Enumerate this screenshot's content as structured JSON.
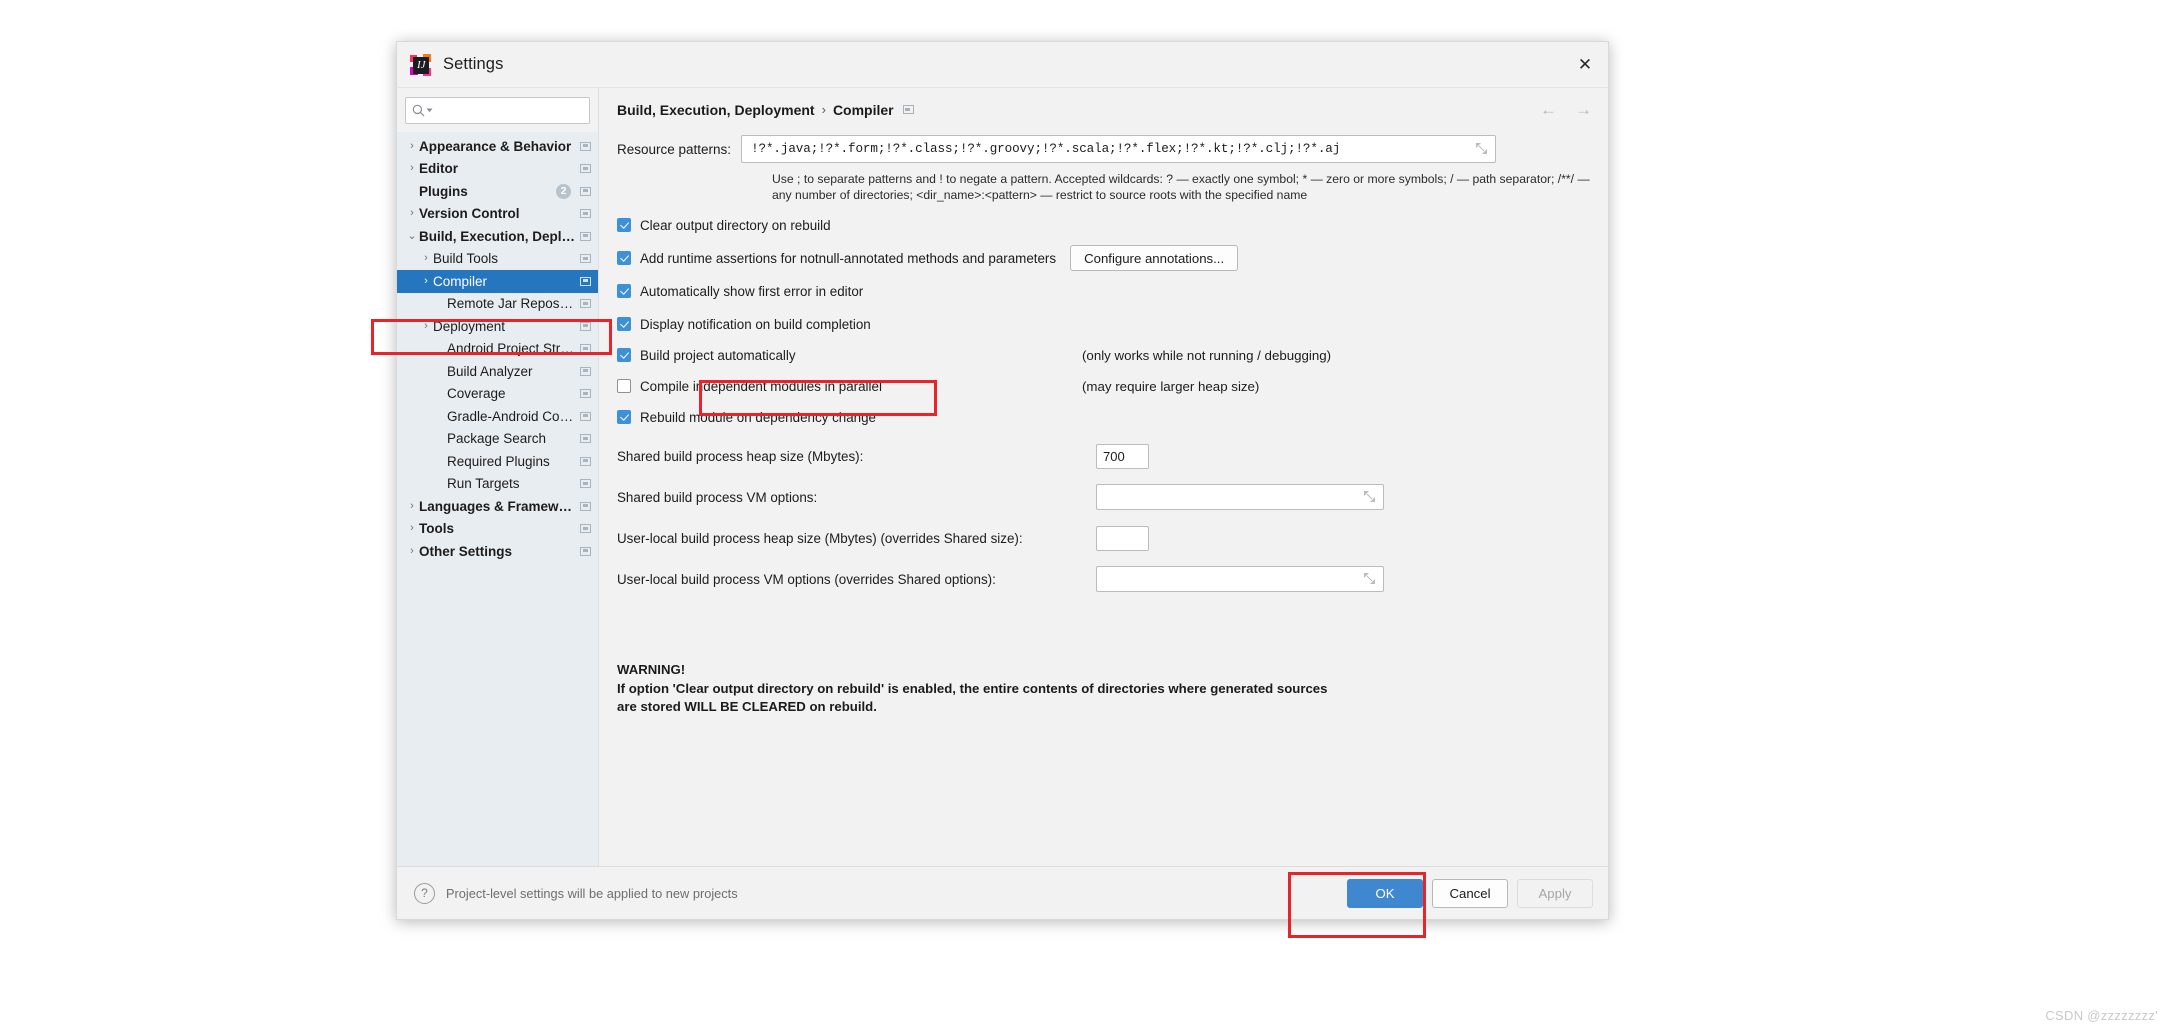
{
  "window": {
    "title": "Settings",
    "app_icon": "intellij-idea-icon",
    "close_label": "✕"
  },
  "search": {
    "placeholder": "",
    "value": "",
    "icon": "search-icon"
  },
  "sidebar": {
    "items": [
      {
        "label": "Appearance & Behavior",
        "arrow": "›",
        "bold": true,
        "indent": 1,
        "selected": false,
        "badge": null,
        "monitor": true
      },
      {
        "label": "Editor",
        "arrow": "›",
        "bold": true,
        "indent": 1,
        "selected": false,
        "badge": null,
        "monitor": true
      },
      {
        "label": "Plugins",
        "arrow": "",
        "bold": true,
        "indent": 1,
        "selected": false,
        "badge": "2",
        "monitor": true
      },
      {
        "label": "Version Control",
        "arrow": "›",
        "bold": true,
        "indent": 1,
        "selected": false,
        "badge": null,
        "monitor": true
      },
      {
        "label": "Build, Execution, Deployment",
        "arrow": "⌄",
        "bold": true,
        "indent": 1,
        "selected": false,
        "badge": null,
        "monitor": true
      },
      {
        "label": "Build Tools",
        "arrow": "›",
        "bold": false,
        "indent": 2,
        "selected": false,
        "badge": null,
        "monitor": true
      },
      {
        "label": "Compiler",
        "arrow": "›",
        "bold": false,
        "indent": 2,
        "selected": true,
        "badge": null,
        "monitor": true
      },
      {
        "label": "Remote Jar Repositories",
        "arrow": "",
        "bold": false,
        "indent": 3,
        "selected": false,
        "badge": null,
        "monitor": true
      },
      {
        "label": "Deployment",
        "arrow": "›",
        "bold": false,
        "indent": 2,
        "selected": false,
        "badge": null,
        "monitor": true
      },
      {
        "label": "Android Project Structure",
        "arrow": "",
        "bold": false,
        "indent": 3,
        "selected": false,
        "badge": null,
        "monitor": true
      },
      {
        "label": "Build Analyzer",
        "arrow": "",
        "bold": false,
        "indent": 3,
        "selected": false,
        "badge": null,
        "monitor": true
      },
      {
        "label": "Coverage",
        "arrow": "",
        "bold": false,
        "indent": 3,
        "selected": false,
        "badge": null,
        "monitor": true
      },
      {
        "label": "Gradle-Android Compiler",
        "arrow": "",
        "bold": false,
        "indent": 3,
        "selected": false,
        "badge": null,
        "monitor": true
      },
      {
        "label": "Package Search",
        "arrow": "",
        "bold": false,
        "indent": 3,
        "selected": false,
        "badge": null,
        "monitor": true
      },
      {
        "label": "Required Plugins",
        "arrow": "",
        "bold": false,
        "indent": 3,
        "selected": false,
        "badge": null,
        "monitor": true
      },
      {
        "label": "Run Targets",
        "arrow": "",
        "bold": false,
        "indent": 3,
        "selected": false,
        "badge": null,
        "monitor": true
      },
      {
        "label": "Languages & Frameworks",
        "arrow": "›",
        "bold": true,
        "indent": 1,
        "selected": false,
        "badge": null,
        "monitor": true
      },
      {
        "label": "Tools",
        "arrow": "›",
        "bold": true,
        "indent": 1,
        "selected": false,
        "badge": null,
        "monitor": true
      },
      {
        "label": "Other Settings",
        "arrow": "›",
        "bold": true,
        "indent": 1,
        "selected": false,
        "badge": null,
        "monitor": true
      }
    ]
  },
  "breadcrumb": {
    "root": "Build, Execution, Deployment",
    "separator": "›",
    "leaf": "Compiler",
    "back_arrow": "←",
    "forward_arrow": "→"
  },
  "main": {
    "resource_patterns": {
      "label": "Resource patterns:",
      "value": "!?*.java;!?*.form;!?*.class;!?*.groovy;!?*.scala;!?*.flex;!?*.kt;!?*.clj;!?*.aj",
      "expand_icon": "expand-icon"
    },
    "hint_text": "Use ; to separate patterns and ! to negate a pattern. Accepted wildcards: ? — exactly one symbol; * — zero or more symbols; / — path separator; /**/ — any number of directories; <dir_name>:<pattern> — restrict to source roots with the specified name",
    "checkboxes": [
      {
        "label": "Clear output directory on rebuild",
        "checked": true,
        "note": "",
        "button": ""
      },
      {
        "label": "Add runtime assertions for notnull-annotated methods and parameters",
        "checked": true,
        "note": "",
        "button": "Configure annotations..."
      },
      {
        "label": "Automatically show first error in editor",
        "checked": true,
        "note": "",
        "button": ""
      },
      {
        "label": "Display notification on build completion",
        "checked": true,
        "note": "",
        "button": ""
      },
      {
        "label": "Build project automatically",
        "checked": true,
        "note": "(only works while not running / debugging)",
        "button": ""
      },
      {
        "label": "Compile independent modules in parallel",
        "checked": false,
        "note": "(may require larger heap size)",
        "button": ""
      },
      {
        "label": "Rebuild module on dependency change",
        "checked": true,
        "note": "",
        "button": ""
      }
    ],
    "fields": [
      {
        "label": "Shared build process heap size (Mbytes):",
        "value": "700",
        "kind": "small",
        "expand": false
      },
      {
        "label": "Shared build process VM options:",
        "value": "",
        "kind": "wide",
        "expand": true
      },
      {
        "label": "User-local build process heap size (Mbytes) (overrides Shared size):",
        "value": "",
        "kind": "small",
        "expand": false
      },
      {
        "label": "User-local build process VM options (overrides Shared options):",
        "value": "",
        "kind": "wide",
        "expand": true
      }
    ],
    "warning": {
      "title": "WARNING!",
      "line1": "If option 'Clear output directory on rebuild' is enabled, the entire contents of directories where generated sources",
      "line2": "are stored WILL BE CLEARED on rebuild."
    }
  },
  "footer": {
    "help_icon": "?",
    "note": "Project-level settings will be applied to new projects",
    "ok_label": "OK",
    "cancel_label": "Cancel",
    "apply_label": "Apply"
  },
  "annotations": {
    "highlight_color": "#e8232a",
    "boxes": [
      "compiler-tree-item",
      "build-project-automatically-checkbox",
      "ok-button"
    ]
  },
  "watermark": "CSDN @zzzzzzzz'"
}
